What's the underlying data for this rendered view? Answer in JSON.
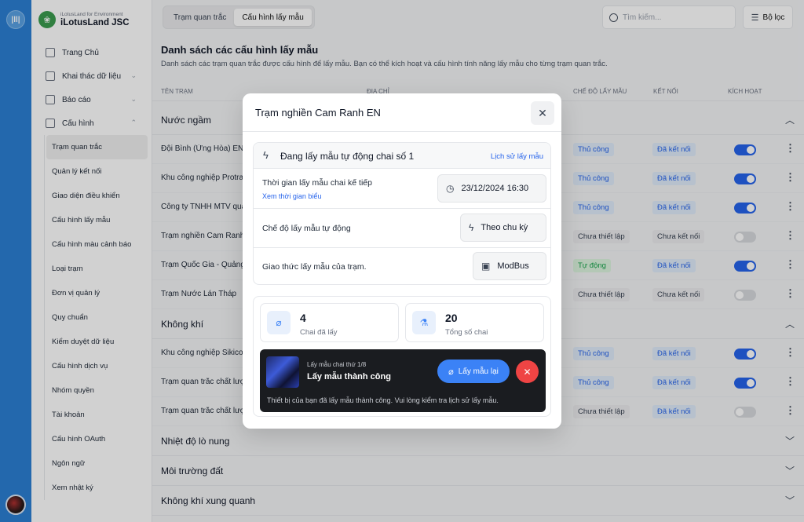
{
  "rail": {
    "logo_text": "|ll|"
  },
  "brand": {
    "subtitle": "iLotusLand for Environment",
    "name": "iLotusLand JSC"
  },
  "nav": {
    "items": [
      {
        "label": "Trang Chủ",
        "icon": "home-icon"
      },
      {
        "label": "Khai thác dữ liệu",
        "icon": "data-icon",
        "chevron": "⌄"
      },
      {
        "label": "Báo cáo",
        "icon": "report-icon",
        "chevron": "⌄"
      },
      {
        "label": "Cấu hình",
        "icon": "config-icon",
        "chevron": "⌃"
      }
    ],
    "sub_items": [
      {
        "label": "Trạm quan trắc",
        "active": true
      },
      {
        "label": "Quản lý kết nối"
      },
      {
        "label": "Giao diện điều khiển"
      },
      {
        "label": "Cấu hình lấy mẫu"
      },
      {
        "label": "Cấu hình màu cảnh báo"
      },
      {
        "label": "Loại trạm"
      },
      {
        "label": "Đơn vị quản lý"
      },
      {
        "label": "Quy chuẩn"
      },
      {
        "label": "Kiểm duyệt dữ liệu"
      },
      {
        "label": "Cấu hình dịch vụ"
      },
      {
        "label": "Nhóm quyền"
      },
      {
        "label": "Tài khoản"
      },
      {
        "label": "Cấu hình OAuth"
      },
      {
        "label": "Ngôn ngữ"
      },
      {
        "label": "Xem nhật ký"
      }
    ]
  },
  "tabs": [
    {
      "label": "Trạm quan trắc"
    },
    {
      "label": "Cấu hình lấy mẫu"
    }
  ],
  "search": {
    "placeholder": "Tìm kiếm..."
  },
  "filter": {
    "label": "Bộ lọc"
  },
  "page": {
    "title": "Danh sách các cấu hình lấy mẫu",
    "description": "Danh sách các trạm quan trắc được cấu hình để lấy mẫu. Bạn có thể kích hoạt và cấu hình tính năng lấy mẫu cho từng trạm quan trắc."
  },
  "table": {
    "headers": {
      "name": "TÊN TRẠM",
      "address": "ĐỊA CHỈ",
      "mode": "CHẾ ĐỘ LẤY MẪU",
      "connection": "KẾT NỐI",
      "active": "KÍCH HOẠT"
    },
    "groups": [
      {
        "title": "Nước ngầm",
        "expanded": true,
        "rows": [
          {
            "name": "Đội Bình (Ửng Hòa) EN",
            "mode": "Thủ công",
            "mode_type": "manual",
            "connection": "Đã kết nối",
            "connected": true,
            "active": true
          },
          {
            "name": "Khu công nghiệp Protrade",
            "mode": "Thủ công",
            "mode_type": "manual",
            "connection": "Đã kết nối",
            "connected": true,
            "active": true
          },
          {
            "name": "Công ty TNHH MTV quản lý",
            "mode": "Thủ công",
            "mode_type": "manual",
            "connection": "Đã kết nối",
            "connected": true,
            "active": true
          },
          {
            "name": "Trạm nghiền Cam Ranh EN",
            "mode": "Chưa thiết lập",
            "mode_type": "unset",
            "connection": "Chưa kết nối",
            "connected": false,
            "active": false
          },
          {
            "name": "Trạm Quốc Gia - Quảng Ngãi",
            "mode": "Tự động",
            "mode_type": "auto",
            "connection": "Đã kết nối",
            "connected": true,
            "active": true
          },
          {
            "name": "Trạm Nước Lán Tháp",
            "mode": "Chưa thiết lập",
            "mode_type": "unset",
            "connection": "Chưa kết nối",
            "connected": false,
            "active": false
          }
        ]
      },
      {
        "title": "Không khí",
        "expanded": true,
        "rows": [
          {
            "name": "Khu công nghiệp Sikico",
            "mode": "Thủ công",
            "mode_type": "manual",
            "connection": "Đã kết nối",
            "connected": true,
            "active": true
          },
          {
            "name": "Trạm quan trắc chất lượng",
            "mode": "Thủ công",
            "mode_type": "manual",
            "connection": "Đã kết nối",
            "connected": true,
            "active": true
          },
          {
            "name": "Trạm quan trắc chất lượng",
            "mode": "Chưa thiết lập",
            "mode_type": "unset",
            "connection": "Đã kết nối",
            "connected": true,
            "active": false
          }
        ]
      },
      {
        "title": "Nhiệt độ lò nung",
        "expanded": false,
        "rows": []
      },
      {
        "title": "Môi trường đất",
        "expanded": false,
        "rows": []
      },
      {
        "title": "Không khí xung quanh",
        "expanded": false,
        "rows": []
      }
    ]
  },
  "modal": {
    "title": "Trạm nghiền Cam Ranh EN",
    "status_title": "Đang lấy mẫu tự động chai số 1",
    "history_link": "Lịch sử lấy mẫu",
    "next_time_label": "Thời gian lấy mẫu chai kế tiếp",
    "schedule_link": "Xem thời gian biểu",
    "next_time_value": "23/12/2024 16:30",
    "auto_mode_label": "Chế độ lấy mẫu tự động",
    "auto_mode_value": "Theo chu kỳ",
    "protocol_label": "Giao thức lấy mẫu của trạm.",
    "protocol_value": "ModBus",
    "stats": [
      {
        "value": "4",
        "label": "Chai đã lấy",
        "icon": "test-tube-icon"
      },
      {
        "value": "20",
        "label": "Tổng số chai",
        "icon": "flask-icon"
      }
    ],
    "toast": {
      "subtitle": "Lấy mẫu chai thứ 1/8",
      "title": "Lấy mẫu thành công",
      "retry_label": "Lấy mẫu lại",
      "message": "Thiết bị của bạn đã lấy mẫu thành công. Vui lòng kiểm tra lịch sử lấy mẫu."
    }
  }
}
